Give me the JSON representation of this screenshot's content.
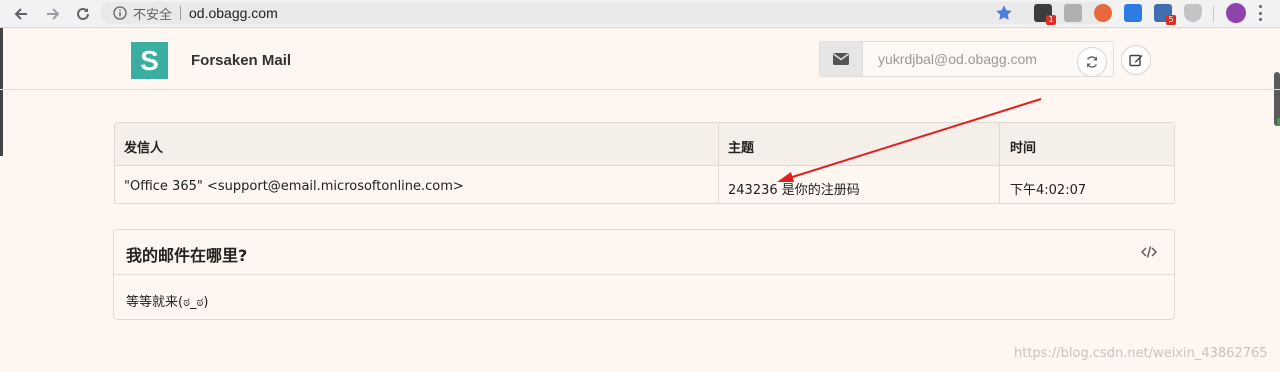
{
  "browser": {
    "secure_label": "不安全",
    "url": "od.obagg.com",
    "extensions": [
      {
        "name": "ext-1",
        "badge": "1",
        "color": "#3c3c3c"
      },
      {
        "name": "ext-2",
        "badge": "",
        "color": "#b0b0b0"
      },
      {
        "name": "ext-3",
        "badge": "",
        "color": "#e8693c"
      },
      {
        "name": "ext-4",
        "badge": "",
        "color": "#2d7be5"
      },
      {
        "name": "ext-5",
        "badge": "5",
        "color": "#3f6fb0"
      },
      {
        "name": "ext-6",
        "badge": "",
        "color": "#c4c4c4"
      }
    ]
  },
  "app": {
    "logo_letter": "S",
    "brand": "Forsaken Mail",
    "email_placeholder": "yukrdjbal@od.obagg.com",
    "accent": "#3aaf9f"
  },
  "table": {
    "headers": [
      "发信人",
      "主题",
      "时间"
    ],
    "rows": [
      {
        "sender": "\"Office 365\" <support@email.microsoftonline.com>",
        "subject": "243236 是你的注册码",
        "time": "下午4:02:07"
      }
    ]
  },
  "panel": {
    "title": "我的邮件在哪里?",
    "body": "等等就来(ಠ_ಠ)"
  },
  "watermark": "https://blog.csdn.net/weixin_43862765"
}
